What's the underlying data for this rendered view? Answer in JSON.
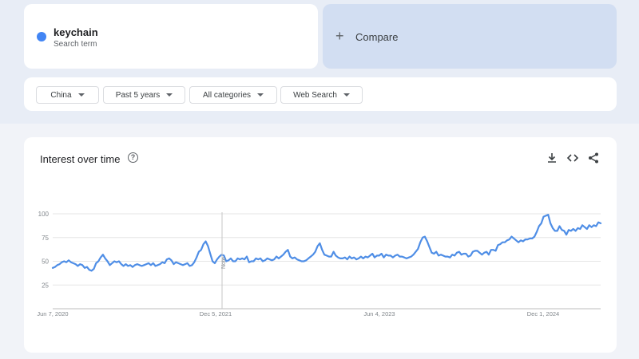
{
  "search_term": {
    "name": "keychain",
    "subtitle": "Search term",
    "color": "#4285f4"
  },
  "compare": {
    "icon": "plus-icon",
    "label": "Compare"
  },
  "filters": {
    "region": "China",
    "period": "Past 5 years",
    "category": "All categories",
    "search_type": "Web Search"
  },
  "panel": {
    "title": "Interest over time",
    "icons": [
      "help-icon",
      "download-icon",
      "embed-code-icon",
      "share-icon"
    ]
  },
  "chart_data": {
    "type": "line",
    "title": "Interest over time",
    "ylim": [
      0,
      100
    ],
    "y_ticks": [
      "100",
      "75",
      "50",
      "25"
    ],
    "x_tick_labels": [
      "Jun 7, 2020",
      "Dec 5, 2021",
      "Jun 4, 2023",
      "Dec 1, 2024"
    ],
    "annotation": "Note",
    "grid": true,
    "series": [
      {
        "color": "#4f8ee6",
        "values": [
          43,
          44,
          46,
          47,
          49,
          50,
          49,
          51,
          49,
          48,
          47,
          45,
          47,
          46,
          43,
          44,
          41,
          40,
          42,
          48,
          50,
          54,
          57,
          53,
          50,
          46,
          48,
          50,
          49,
          50,
          47,
          45,
          47,
          45,
          46,
          44,
          46,
          47,
          46,
          45,
          46,
          47,
          48,
          46,
          48,
          45,
          46,
          47,
          49,
          48,
          52,
          53,
          51,
          47,
          49,
          48,
          47,
          46,
          47,
          48,
          45,
          46,
          49,
          54,
          60,
          62,
          68,
          71,
          66,
          58,
          50,
          48,
          52,
          55,
          57,
          56,
          50,
          51,
          53,
          50,
          50,
          53,
          52,
          53,
          52,
          55,
          49,
          50,
          50,
          53,
          52,
          53,
          50,
          51,
          53,
          52,
          51,
          52,
          55,
          53,
          55,
          57,
          60,
          62,
          55,
          53,
          54,
          52,
          51,
          50,
          50,
          51,
          53,
          55,
          57,
          60,
          66,
          69,
          62,
          57,
          56,
          55,
          55,
          60,
          56,
          54,
          53,
          53,
          54,
          52,
          55,
          53,
          54,
          52,
          53,
          55,
          53,
          55,
          54,
          56,
          58,
          54,
          56,
          56,
          58,
          54,
          57,
          56,
          56,
          54,
          56,
          57,
          55,
          55,
          54,
          53,
          54,
          55,
          57,
          60,
          63,
          70,
          75,
          76,
          71,
          65,
          59,
          58,
          60,
          56,
          57,
          56,
          55,
          55,
          54,
          57,
          56,
          59,
          60,
          57,
          58,
          58,
          55,
          56,
          60,
          61,
          61,
          59,
          57,
          59,
          60,
          57,
          62,
          62,
          61,
          67,
          68,
          70,
          70,
          72,
          73,
          76,
          74,
          72,
          70,
          72,
          71,
          73,
          73,
          74,
          74,
          76,
          81,
          87,
          90,
          97,
          98,
          99,
          90,
          85,
          82,
          82,
          87,
          83,
          82,
          78,
          83,
          82,
          84,
          82,
          85,
          84,
          88,
          86,
          84,
          88,
          86,
          88,
          87,
          91,
          90
        ]
      }
    ]
  }
}
